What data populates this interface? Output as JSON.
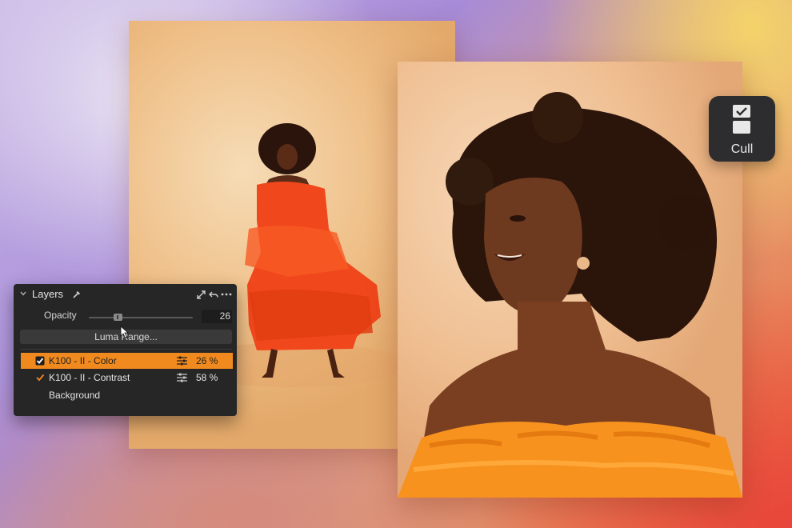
{
  "cull": {
    "label": "Cull",
    "icon": "cull-icon"
  },
  "layers_panel": {
    "title": "Layers",
    "icons": [
      "chevron-down-icon",
      "color-picker-icon",
      "expand-icon",
      "undo-icon",
      "more-icon"
    ],
    "opacity": {
      "label": "Opacity",
      "value": "26",
      "level": 0.26
    },
    "luma_button": "Luma Range...",
    "layers": [
      {
        "name": "K100 - II - Color",
        "value": "26 %",
        "checked": true,
        "selected": true
      },
      {
        "name": "K100 - II - Contrast",
        "value": "58 %",
        "checked": true,
        "selected": false
      },
      {
        "name": "Background",
        "value": "",
        "checked": false,
        "selected": false
      }
    ]
  },
  "colors": {
    "accent": "#f18a1e",
    "panel": "#262627",
    "cull_bg": "#2d2d2f"
  }
}
